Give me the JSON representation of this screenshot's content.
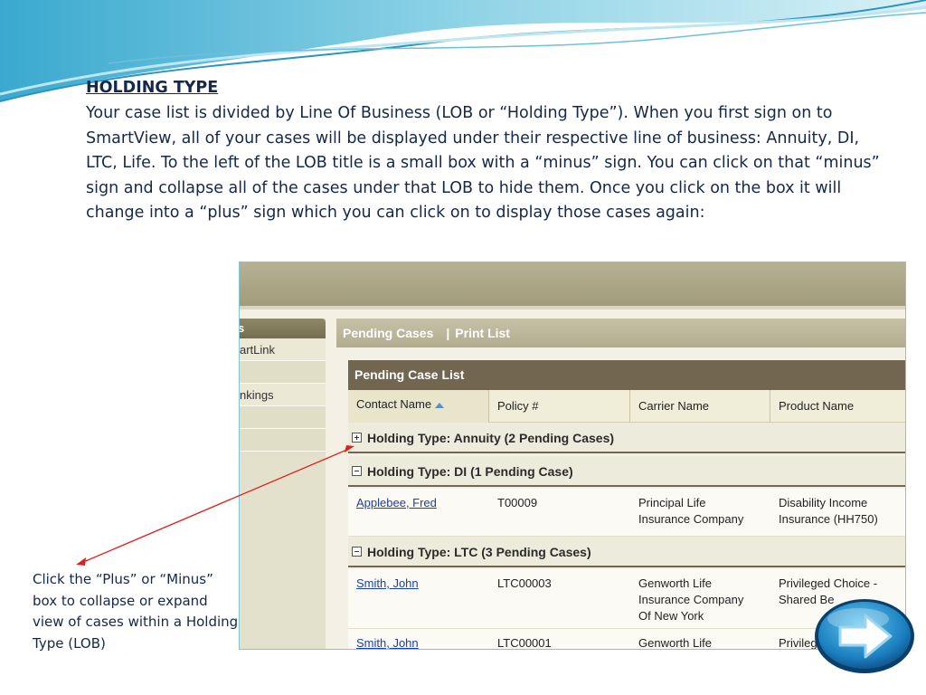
{
  "slide": {
    "heading": "HOLDING TYPE",
    "intro": "Your case list is divided by Line Of Business (LOB or “Holding Type”).  When you first sign on to SmartView, all of your cases will be displayed under their respective line of business:  Annuity, DI, LTC, Life.  To the left of the LOB title is a small box with a “minus” sign.  You can click on that “minus” sign and collapse all of the cases under that LOB to hide them.  Once you click on the box it will change into a “plus” sign which you can click on to display those cases again:",
    "note": "Click the “Plus” or “Minus” box to collapse or expand view of cases within a Holding Type (LOB)"
  },
  "sidebar": {
    "header": "s",
    "items": [
      "artLink",
      "",
      "nkings",
      "",
      ""
    ]
  },
  "main": {
    "tab_pending": "Pending Cases",
    "separator": "|",
    "tab_print": "Print List",
    "list_title": "Pending Case List",
    "columns": [
      "Contact Name",
      "Policy #",
      "Carrier Name",
      "Product Name"
    ]
  },
  "groups": [
    {
      "label": "Holding Type: Annuity (2 Pending Cases)",
      "state": "collapsed"
    },
    {
      "label": "Holding Type: DI (1 Pending Case)",
      "state": "expanded"
    },
    {
      "label": "Holding Type: LTC (3 Pending Cases)",
      "state": "expanded"
    }
  ],
  "rows": [
    {
      "contact": "Applebee, Fred",
      "policy": "T00009",
      "carrier": "Principal Life\nInsurance Company",
      "product": "Disability Income\nInsurance (HH750)"
    },
    {
      "contact": "Smith, John",
      "policy": "LTC00003",
      "carrier": "Genworth Life\nInsurance Company\nOf New York",
      "product": "Privileged Choice -\nShared Be"
    },
    {
      "contact": "Smith, John",
      "policy": "LTC00001",
      "carrier": "Genworth Life",
      "product": "Privilege"
    }
  ],
  "icons": {
    "sort": "sort-ascending-icon",
    "next": "next-arrow-icon"
  },
  "colors": {
    "text": "#14284b",
    "list_header": "#726650",
    "link": "#1b3fa8",
    "annotation_arrow": "#e0201c"
  }
}
